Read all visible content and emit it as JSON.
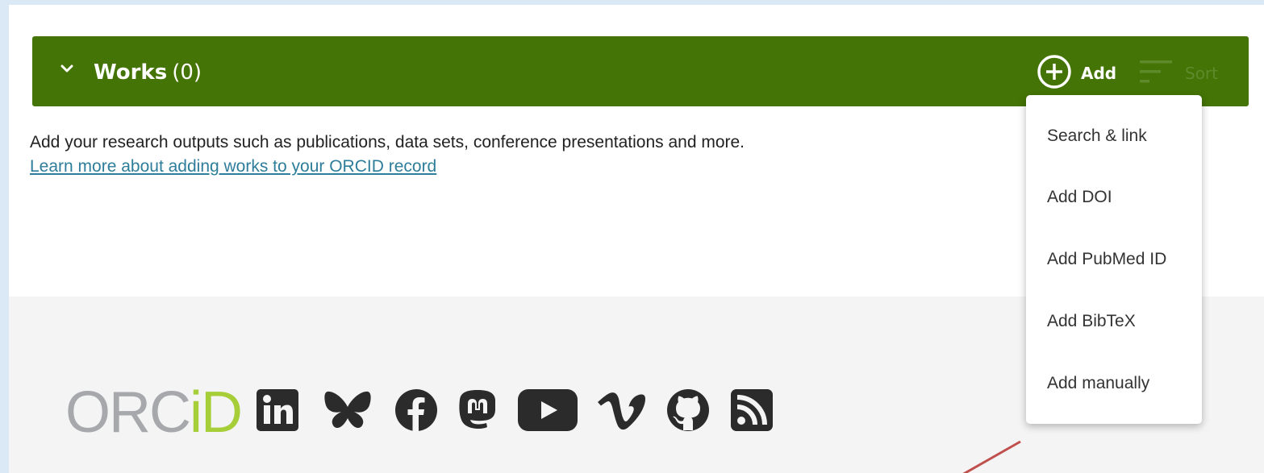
{
  "works": {
    "title": "Works",
    "count": "(0)",
    "add_label": "Add",
    "sort_label": "Sort",
    "intro_text": "Add your research outputs such as publications, data sets, conference presentations and more.",
    "learn_more_link": "Learn more about adding works to your ORCID record"
  },
  "add_menu": {
    "items": [
      {
        "label": "Search & link"
      },
      {
        "label": "Add DOI"
      },
      {
        "label": "Add PubMed ID"
      },
      {
        "label": "Add BibTeX"
      },
      {
        "label": "Add manually"
      }
    ]
  },
  "footer": {
    "logo_part1": "ORC",
    "logo_part2": "iD",
    "social_icons": [
      "linkedin-icon",
      "bluesky-icon",
      "facebook-icon",
      "mastodon-icon",
      "youtube-icon",
      "vimeo-icon",
      "github-icon",
      "rss-icon"
    ]
  },
  "colors": {
    "page_background": "#dbe9f7",
    "header_green": "#447405",
    "sort_muted": "#5f8a2c",
    "link": "#2e7d9a",
    "footer_background": "#f4f4f4",
    "logo_grey": "#a6a8ab",
    "logo_green": "#a6ce39",
    "social_icon": "#2b2b2b",
    "annotation_arrow": "#c0504d"
  }
}
